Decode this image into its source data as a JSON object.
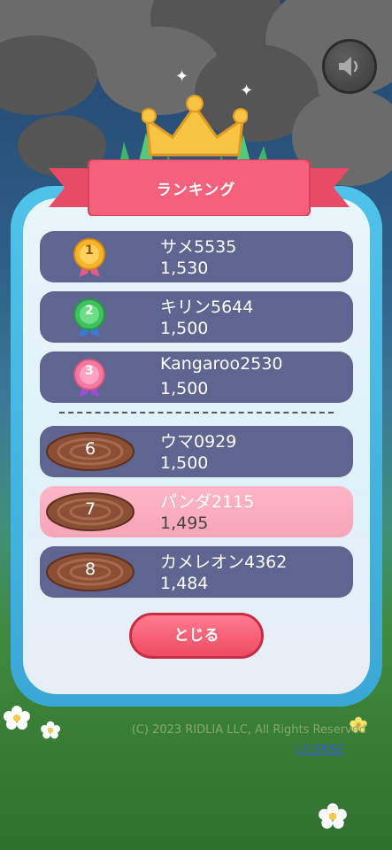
{
  "title": "ランキング",
  "rankings": [
    {
      "rank": "1",
      "name": "サメ5535",
      "score": "1,530",
      "medal": "gold-medal-icon"
    },
    {
      "rank": "2",
      "name": "キリン5644",
      "score": "1,500",
      "medal": "green-medal-icon"
    },
    {
      "rank": "3",
      "name": "Kangaroo2530",
      "score": "1,500",
      "medal": "pink-medal-icon"
    }
  ],
  "nearby": [
    {
      "rank": "6",
      "name": "ウマ0929",
      "score": "1,500"
    },
    {
      "rank": "7",
      "name": "パンダ2115",
      "score": "1,495"
    },
    {
      "rank": "8",
      "name": "カメレオン4362",
      "score": "1,484"
    }
  ],
  "close_label": "とじる",
  "copyright": "(C) 2023 RIDLIA LLC, All Rights Reserved",
  "license_label": "LICENSE",
  "colors": {
    "row": "#5e6590",
    "highlight": "#ffb6c7",
    "ribbon": "#f5607a",
    "panel": "#4fc3ea"
  }
}
